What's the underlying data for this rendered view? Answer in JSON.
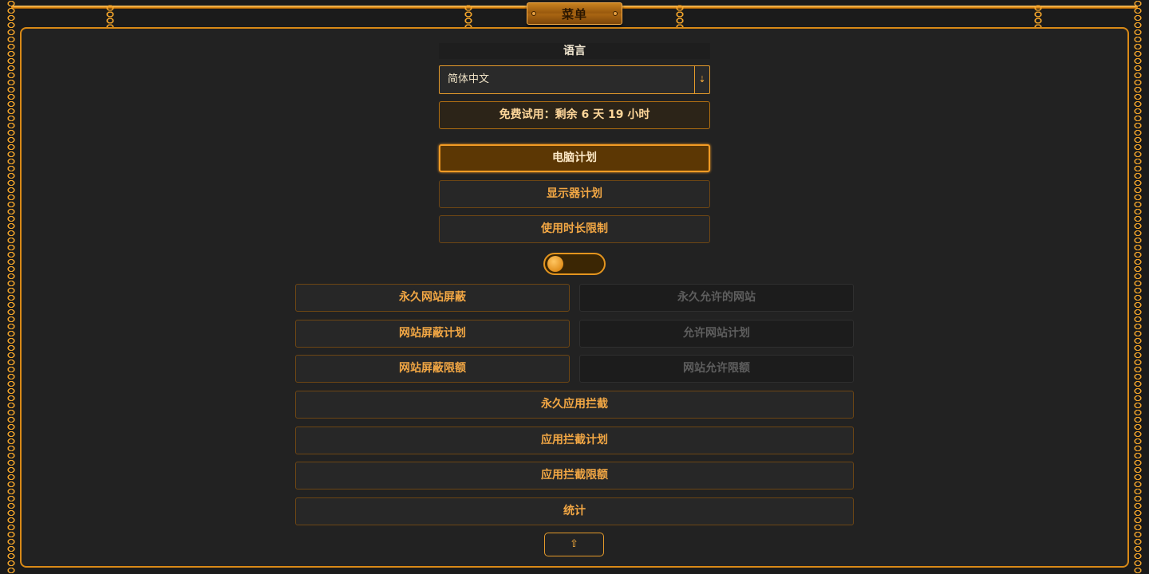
{
  "menu": {
    "title": "菜单"
  },
  "language": {
    "heading": "语言",
    "selected": "简体中文",
    "dropdown_icon": "down-arrow-icon"
  },
  "trial": {
    "text": "免费试用：剩余 6 天 19 小时"
  },
  "plans": {
    "computer_plan": "电脑计划",
    "monitor_plan": "显示器计划",
    "usage_limit": "使用时长限制"
  },
  "toggle": {
    "state": "off"
  },
  "websites": {
    "block_permanent": "永久网站屏蔽",
    "allow_permanent": "永久允许的网站",
    "block_schedule": "网站屏蔽计划",
    "allow_schedule": "允许网站计划",
    "block_quota": "网站屏蔽限额",
    "allow_quota": "网站允许限额"
  },
  "apps": {
    "block_permanent": "永久应用拦截",
    "block_schedule": "应用拦截计划",
    "block_quota": "应用拦截限额"
  },
  "stats": {
    "label": "统计"
  },
  "footer": {
    "up_icon": "up-arrow-icon"
  },
  "colors": {
    "accent": "#f39b25",
    "active_bg": "#5c3704",
    "panel_bg": "#222222",
    "disabled_text": "#5e5e5e"
  }
}
